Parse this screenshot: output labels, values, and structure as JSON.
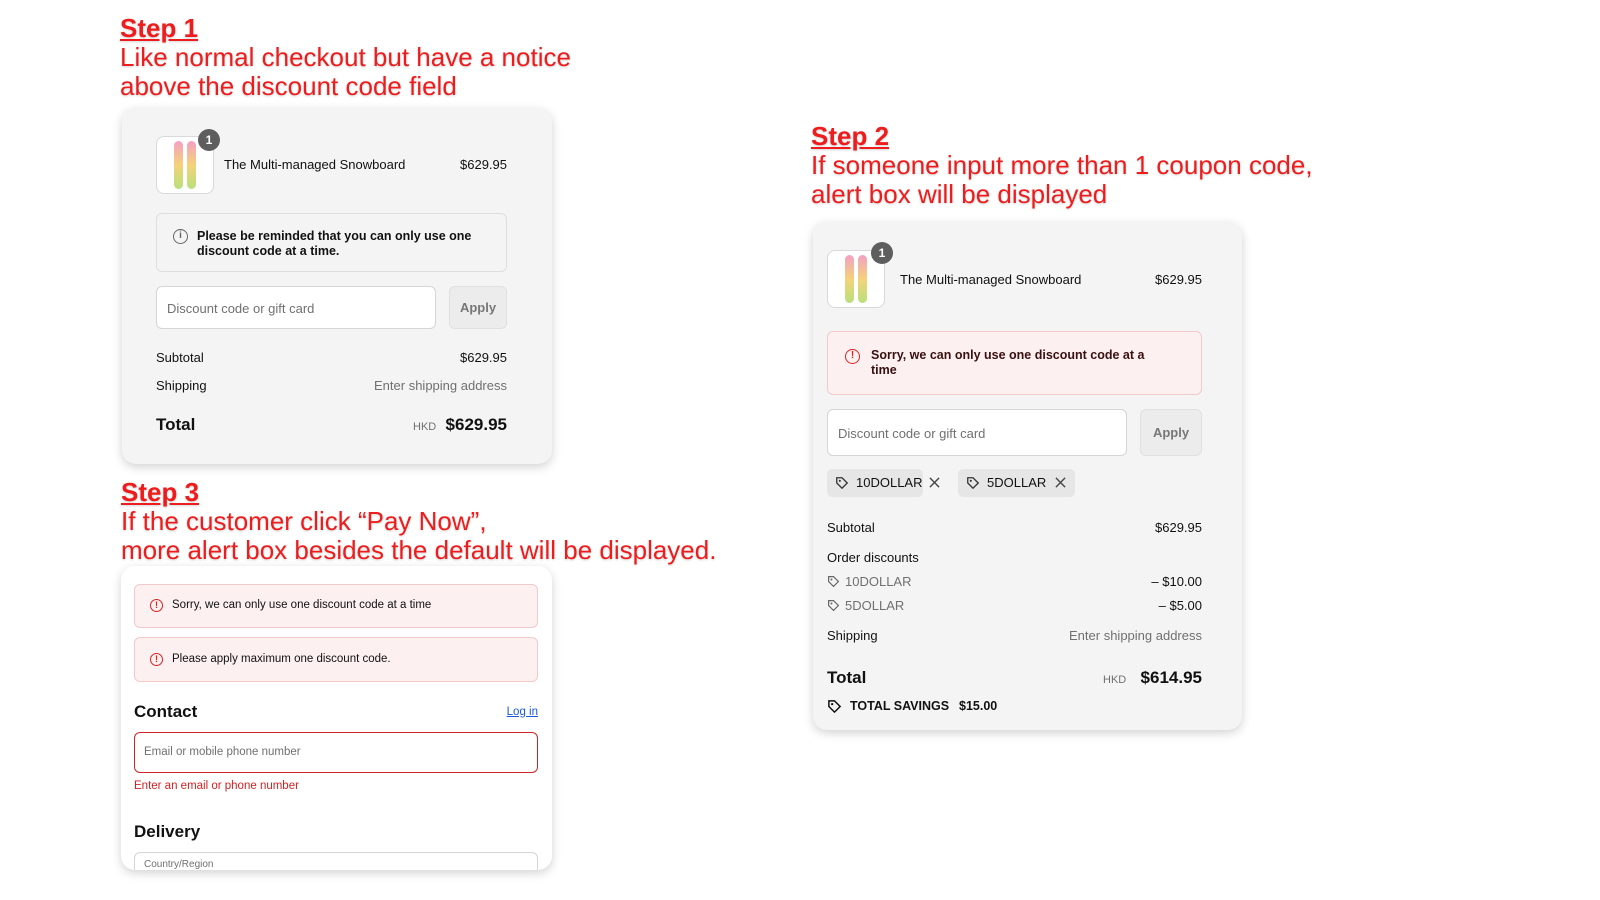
{
  "step1": {
    "heading": "Step 1",
    "lines": [
      "Like normal checkout but have a notice",
      "above the discount code field"
    ]
  },
  "step2": {
    "heading": "Step 2",
    "lines": [
      "If someone input more than 1 coupon code,",
      "alert box will be displayed"
    ]
  },
  "step3": {
    "heading": "Step 3",
    "lines": [
      "If the customer click “Pay Now”,",
      "more alert box besides the default will be displayed."
    ]
  },
  "product": {
    "name": "The Multi-managed Snowboard",
    "price": "$629.95",
    "quantity": "1"
  },
  "card1": {
    "notice": "Please be reminded that you can only use one discount code at a time.",
    "discount_placeholder": "Discount code or gift card",
    "apply_label": "Apply",
    "subtotal_label": "Subtotal",
    "subtotal_value": "$629.95",
    "shipping_label": "Shipping",
    "shipping_value": "Enter shipping address",
    "total_label": "Total",
    "currency": "HKD",
    "total_value": "$629.95"
  },
  "card2": {
    "alert": "Sorry, we can only use one discount code at a time",
    "discount_placeholder": "Discount code or gift card",
    "apply_label": "Apply",
    "tags": [
      "10DOLLAR",
      "5DOLLAR"
    ],
    "subtotal_label": "Subtotal",
    "subtotal_value": "$629.95",
    "order_discounts_label": "Order discounts",
    "discounts": [
      {
        "code": "10DOLLAR",
        "amount": "– $10.00"
      },
      {
        "code": "5DOLLAR",
        "amount": "– $5.00"
      }
    ],
    "shipping_label": "Shipping",
    "shipping_value": "Enter shipping address",
    "total_label": "Total",
    "currency": "HKD",
    "total_value": "$614.95",
    "savings_label": "TOTAL SAVINGS",
    "savings_value": "$15.00"
  },
  "card3": {
    "alerts": [
      "Sorry, we can only use one discount code at a time",
      "Please apply maximum one discount code."
    ],
    "contact_heading": "Contact",
    "login_link": "Log in",
    "email_placeholder": "Email or mobile phone number",
    "email_error": "Enter an email or phone number",
    "delivery_heading": "Delivery",
    "country_label": "Country/Region"
  },
  "colors": {
    "annotation": "#ee1c1c",
    "alert_bg": "#fdf0f0",
    "alert_border": "#f4c9c9",
    "error_red": "#d22222",
    "link_blue": "#1a5ad7"
  },
  "icons": {
    "info": "info-circle-icon",
    "alert": "alert-circle-icon",
    "tag": "tag-icon",
    "close": "close-icon"
  }
}
